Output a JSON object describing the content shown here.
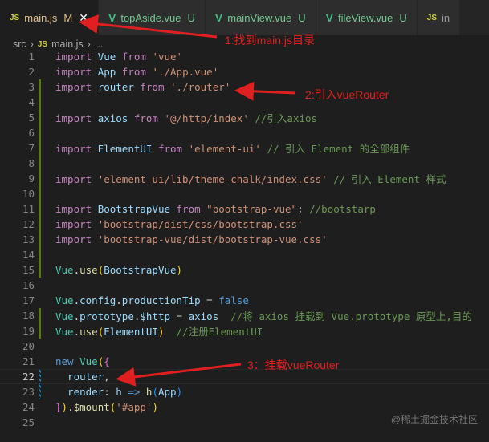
{
  "tabs": [
    {
      "icon": "JS",
      "label": "main.js",
      "status": "M",
      "close": "✕",
      "active": true,
      "type": "js"
    },
    {
      "icon": "V",
      "label": "topAside.vue",
      "status": "U",
      "type": "vue"
    },
    {
      "icon": "V",
      "label": "mainView.vue",
      "status": "U",
      "type": "vue"
    },
    {
      "icon": "V",
      "label": "fileView.vue",
      "status": "U",
      "type": "vue"
    },
    {
      "icon": "JS",
      "label": "in",
      "type": "js"
    }
  ],
  "breadcrumb": {
    "folder": "src",
    "sep1": "›",
    "icon": "JS",
    "file": "main.js",
    "sep2": "›",
    "more": "..."
  },
  "code": [
    [
      [
        "import ",
        "kw"
      ],
      [
        "Vue ",
        "id"
      ],
      [
        "from ",
        "kw"
      ],
      [
        "'vue'",
        "str"
      ]
    ],
    [
      [
        "import ",
        "kw"
      ],
      [
        "App ",
        "id"
      ],
      [
        "from ",
        "kw"
      ],
      [
        "'./App.vue'",
        "str"
      ]
    ],
    [
      [
        "import ",
        "kw"
      ],
      [
        "router ",
        "id"
      ],
      [
        "from ",
        "kw"
      ],
      [
        "'./router'",
        "str"
      ]
    ],
    [],
    [
      [
        "import ",
        "kw"
      ],
      [
        "axios ",
        "id"
      ],
      [
        "from ",
        "kw"
      ],
      [
        "'@/http/index' ",
        "str"
      ],
      [
        "//引入axios",
        "cm"
      ]
    ],
    [],
    [
      [
        "import ",
        "kw"
      ],
      [
        "ElementUI ",
        "id"
      ],
      [
        "from ",
        "kw"
      ],
      [
        "'element-ui' ",
        "str"
      ],
      [
        "// 引入 Element 的全部组件",
        "cm"
      ]
    ],
    [],
    [
      [
        "import ",
        "kw"
      ],
      [
        "'element-ui/lib/theme-chalk/index.css' ",
        "str"
      ],
      [
        "// 引入 Element 样式",
        "cm"
      ]
    ],
    [],
    [
      [
        "import ",
        "kw"
      ],
      [
        "BootstrapVue ",
        "id"
      ],
      [
        "from ",
        "kw"
      ],
      [
        "\"bootstrap-vue\"",
        "str"
      ],
      [
        "; ",
        "p"
      ],
      [
        "//bootstarp",
        "cm"
      ]
    ],
    [
      [
        "import ",
        "kw"
      ],
      [
        "'bootstrap/dist/css/bootstrap.css'",
        "str"
      ]
    ],
    [
      [
        "import ",
        "kw"
      ],
      [
        "'bootstrap-vue/dist/bootstrap-vue.css'",
        "str"
      ]
    ],
    [],
    [
      [
        "Vue",
        "cls"
      ],
      [
        ".",
        "p"
      ],
      [
        "use",
        "fn"
      ],
      [
        "(",
        "by"
      ],
      [
        "BootstrapVue",
        "id"
      ],
      [
        ")",
        "by"
      ]
    ],
    [],
    [
      [
        "Vue",
        "cls"
      ],
      [
        ".",
        "p"
      ],
      [
        "config",
        "id"
      ],
      [
        ".",
        "p"
      ],
      [
        "productionTip ",
        "id"
      ],
      [
        "= ",
        "p"
      ],
      [
        "false",
        "bl"
      ]
    ],
    [
      [
        "Vue",
        "cls"
      ],
      [
        ".",
        "p"
      ],
      [
        "prototype",
        "id"
      ],
      [
        ".",
        "p"
      ],
      [
        "$http ",
        "id"
      ],
      [
        "= ",
        "p"
      ],
      [
        "axios  ",
        "id"
      ],
      [
        "//将 axios 挂载到 Vue.prototype 原型上,目的",
        "cm"
      ]
    ],
    [
      [
        "Vue",
        "cls"
      ],
      [
        ".",
        "p"
      ],
      [
        "use",
        "fn"
      ],
      [
        "(",
        "by"
      ],
      [
        "ElementUI",
        "id"
      ],
      [
        ")  ",
        "by"
      ],
      [
        "//注册ElementUI",
        "cm"
      ]
    ],
    [],
    [
      [
        "new ",
        "bl"
      ],
      [
        "Vue",
        "cls"
      ],
      [
        "(",
        "by"
      ],
      [
        "{",
        "br"
      ]
    ],
    [
      [
        "  router",
        "id"
      ],
      [
        ",",
        "p"
      ]
    ],
    [
      [
        "  render",
        "id"
      ],
      [
        ": ",
        "p"
      ],
      [
        "h ",
        "id"
      ],
      [
        "=> ",
        "bl"
      ],
      [
        "h",
        "fn"
      ],
      [
        "(",
        "bb"
      ],
      [
        "App",
        "id"
      ],
      [
        ")",
        "bb"
      ]
    ],
    [
      [
        "}",
        "br"
      ],
      [
        ")",
        "by"
      ],
      [
        ".",
        "p"
      ],
      [
        "$mount",
        "fn"
      ],
      [
        "(",
        "by"
      ],
      [
        "'#app'",
        "str"
      ],
      [
        ")",
        "by"
      ]
    ],
    []
  ],
  "annotations": {
    "a1": "1:找到main.js目录",
    "a2": "2:引入vueRouter",
    "a3": "3：挂载vueRouter"
  },
  "watermark": "@稀土掘金技术社区"
}
